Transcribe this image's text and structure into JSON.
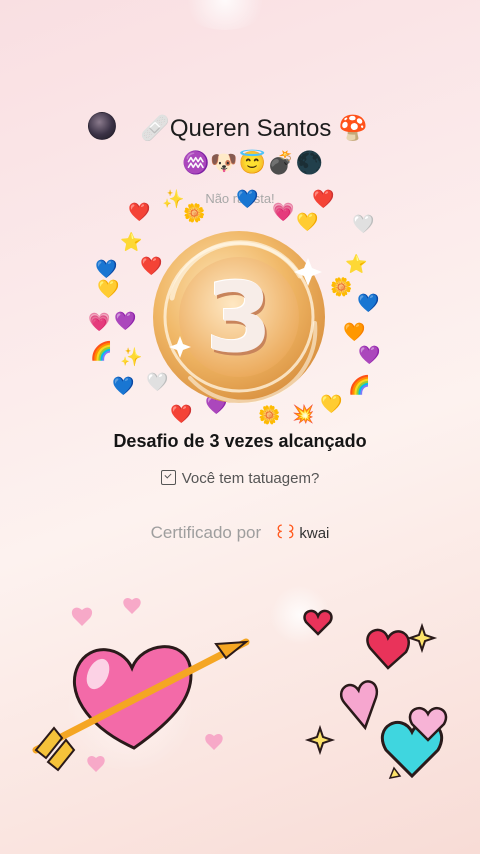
{
  "profile": {
    "name": "🩹Queren Santos 🍄",
    "badges": "♒🐶😇💣🌑",
    "subtitle": "Não racista!"
  },
  "challenge": {
    "number": "3",
    "title": "Desafio de 3 vezes alcançado",
    "question": "Você tem tatuagem?"
  },
  "certification": {
    "label": "Certificado por",
    "brand": "kwai"
  },
  "colors": {
    "medal_gold": "#f0b766",
    "brand_orange": "#ff5a1f"
  },
  "icons": [
    "calendar-check-icon",
    "avatar",
    "heart-icon",
    "arrow-icon",
    "sparkle-icon"
  ]
}
